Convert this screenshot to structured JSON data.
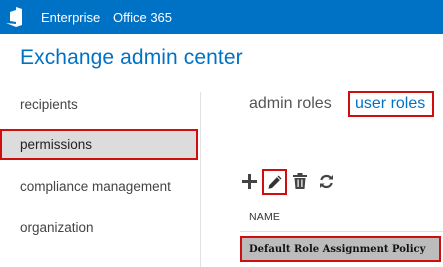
{
  "topbar": {
    "logo_icon": "office-logo-icon",
    "links": [
      "Enterprise",
      "Office 365"
    ],
    "background": "#0072c6"
  },
  "app_title": "Exchange admin center",
  "nav": {
    "items": [
      "recipients",
      "permissions",
      "compliance management",
      "organization"
    ],
    "selected": "permissions"
  },
  "tabs": {
    "admin_roles": "admin roles",
    "user_roles": "user roles",
    "selected": "user roles"
  },
  "toolbar": {
    "icons": [
      "add-icon",
      "edit-icon",
      "delete-icon",
      "refresh-icon"
    ]
  },
  "table": {
    "columns": [
      "NAME"
    ],
    "rows": [
      "Default Role Assignment Policy"
    ],
    "selected_row": "Default Role Assignment Policy"
  },
  "colors": {
    "accent": "#0072c6",
    "highlight_box": "#d10d0d",
    "selected_nav_bg": "#dcdcdc",
    "selected_row_bg": "#bcbcbc"
  }
}
